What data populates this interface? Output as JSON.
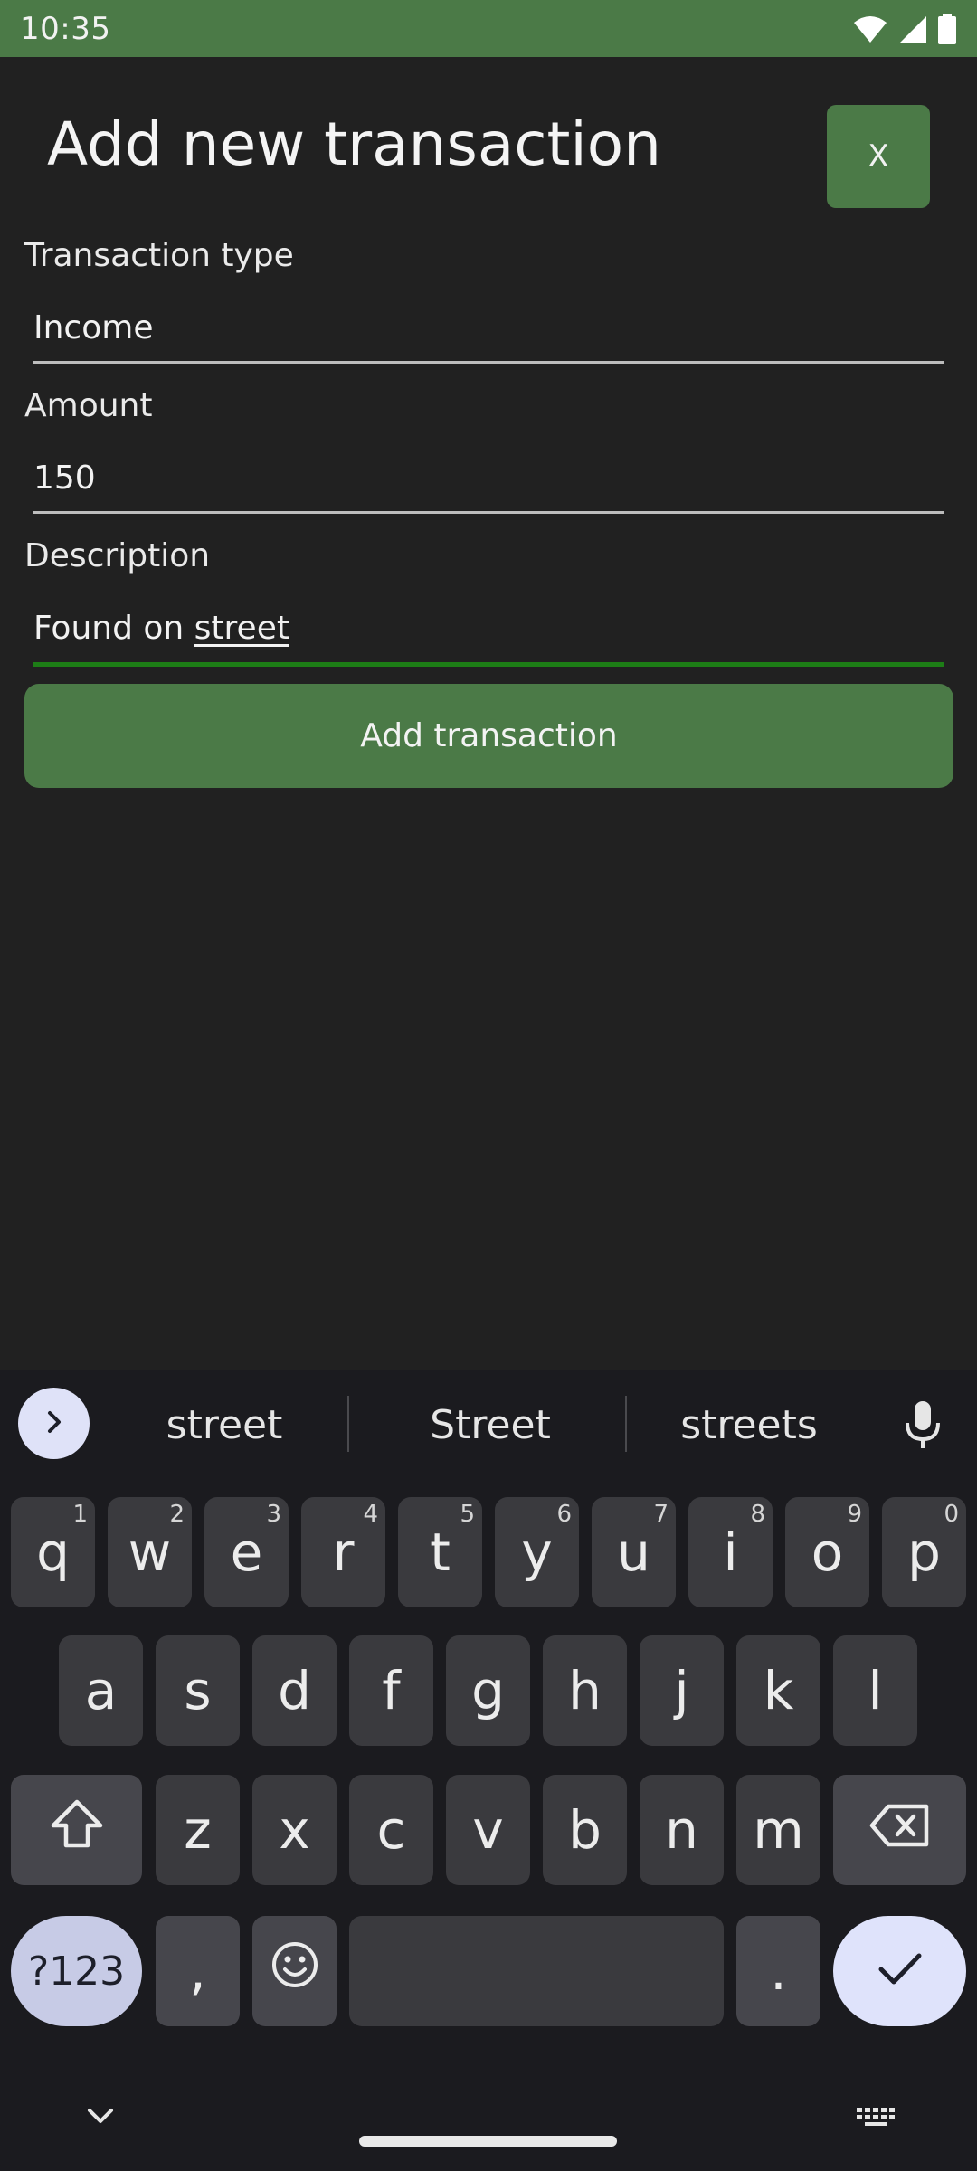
{
  "status_bar": {
    "time": "10:35"
  },
  "header": {
    "title": "Add new transaction",
    "close_label": "X"
  },
  "form": {
    "type_label": "Transaction type",
    "type_value": "Income",
    "amount_label": "Amount",
    "amount_value": "150",
    "description_label": "Description",
    "description_prefix": "Found on ",
    "description_composing": "street",
    "submit_label": "Add transaction"
  },
  "keyboard": {
    "suggestions": [
      "street",
      "Street",
      "streets"
    ],
    "row1": [
      {
        "key": "q",
        "hint": "1"
      },
      {
        "key": "w",
        "hint": "2"
      },
      {
        "key": "e",
        "hint": "3"
      },
      {
        "key": "r",
        "hint": "4"
      },
      {
        "key": "t",
        "hint": "5"
      },
      {
        "key": "y",
        "hint": "6"
      },
      {
        "key": "u",
        "hint": "7"
      },
      {
        "key": "i",
        "hint": "8"
      },
      {
        "key": "o",
        "hint": "9"
      },
      {
        "key": "p",
        "hint": "0"
      }
    ],
    "row2": [
      "a",
      "s",
      "d",
      "f",
      "g",
      "h",
      "j",
      "k",
      "l"
    ],
    "row3": [
      "z",
      "x",
      "c",
      "v",
      "b",
      "n",
      "m"
    ],
    "symbols_label": "?123",
    "comma": ",",
    "period": "."
  },
  "colors": {
    "accent": "#4b7a47",
    "background": "#212121",
    "focus_line": "#1d7d16",
    "keyboard_bg": "#1b1b1f"
  },
  "icons": [
    "wifi-icon",
    "signal-icon",
    "battery-icon",
    "chevron-right-icon",
    "mic-icon",
    "shift-icon",
    "backspace-icon",
    "emoji-icon",
    "check-icon",
    "chevron-down-icon",
    "keyboard-icon"
  ]
}
